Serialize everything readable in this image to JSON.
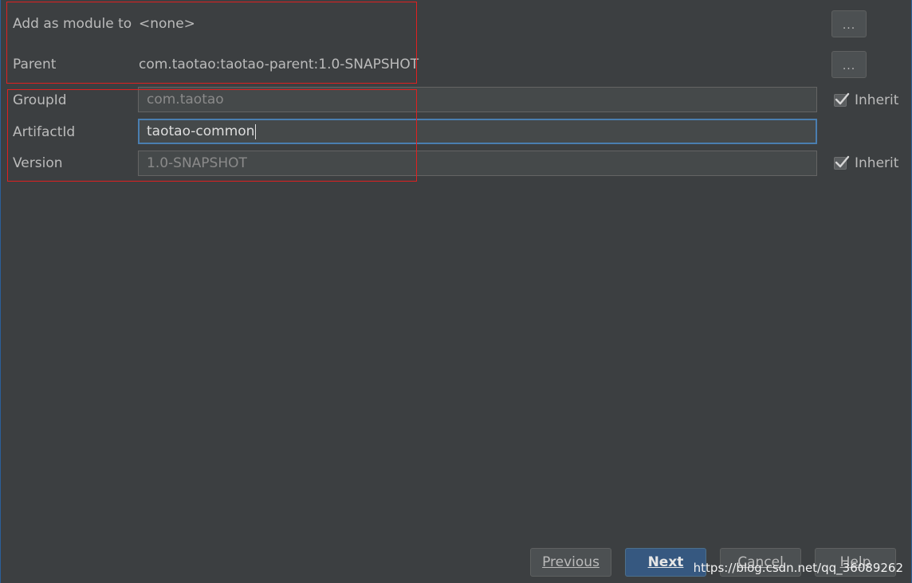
{
  "form": {
    "module": {
      "label": "Add as module to",
      "value": "<none>",
      "button": "..."
    },
    "parent": {
      "label": "Parent",
      "value": "com.taotao:taotao-parent:1.0-SNAPSHOT",
      "button": "..."
    },
    "groupId": {
      "label": "GroupId",
      "value": "com.taotao",
      "inherit_label": "Inherit",
      "inherit_checked": true
    },
    "artifactId": {
      "label": "ArtifactId",
      "value": "taotao-common"
    },
    "version": {
      "label": "Version",
      "value": "1.0-SNAPSHOT",
      "inherit_label": "Inherit",
      "inherit_checked": true
    }
  },
  "buttons": {
    "previous": "Previous",
    "next": "Next",
    "cancel": "Cancel",
    "help": "Help"
  },
  "watermark": "https://blog.csdn.net/qq_36089262",
  "colors": {
    "background": "#3c3f41",
    "field_background": "#45494a",
    "primary_button": "#365880",
    "focus_border": "#4a7eb0",
    "annotation_box": "#e02020",
    "text": "#bbbbbb"
  }
}
